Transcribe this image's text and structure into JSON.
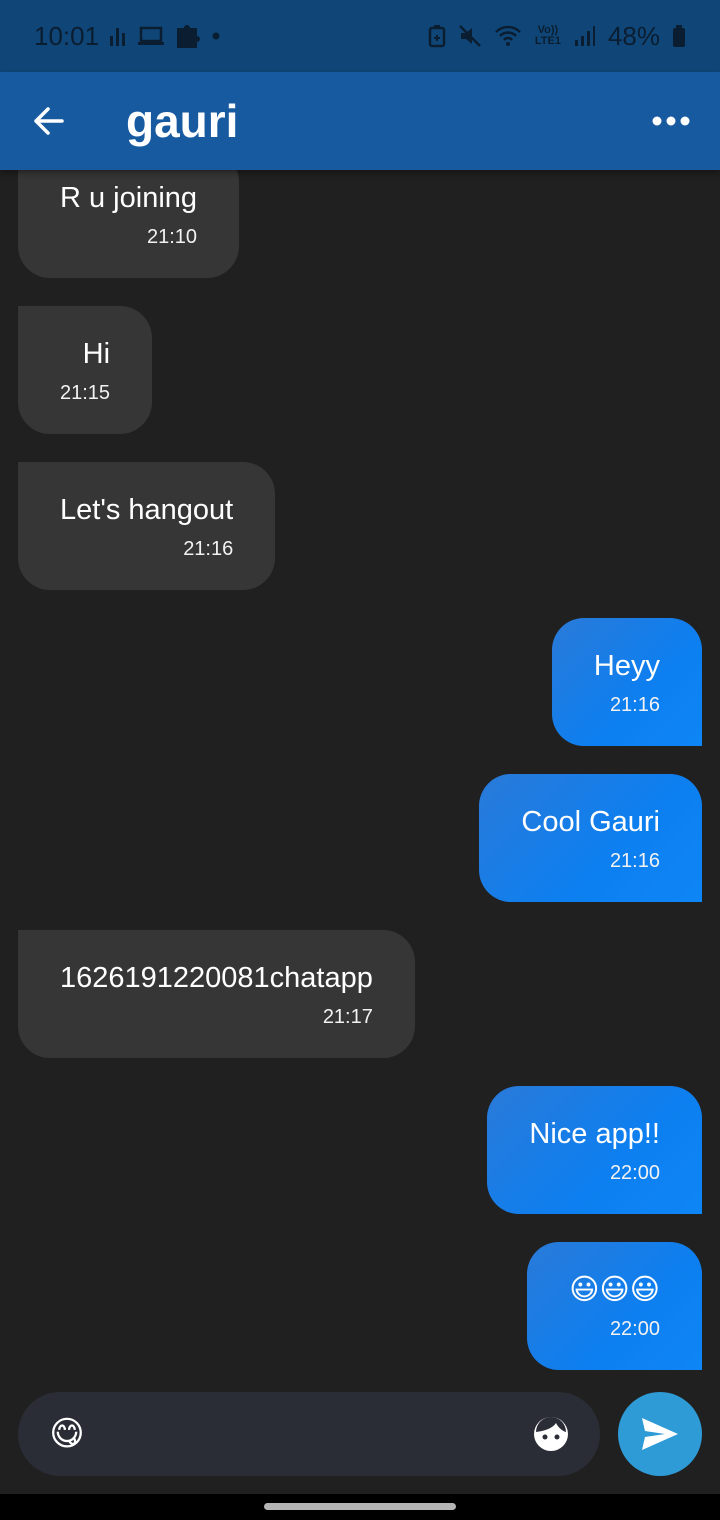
{
  "status_bar": {
    "time": "10:01",
    "battery": "48%",
    "network_label": "Vo)) LTE1"
  },
  "app_bar": {
    "title": "gauri",
    "back_icon": "arrow-left-icon",
    "more_icon": "more-horizontal-icon"
  },
  "messages": [
    {
      "direction": "incoming",
      "text": "R u joining",
      "time": "21:10"
    },
    {
      "direction": "incoming",
      "text": "Hi",
      "time": "21:15"
    },
    {
      "direction": "incoming",
      "text": "Let's hangout",
      "time": "21:16"
    },
    {
      "direction": "outgoing",
      "text": "Heyy",
      "time": "21:16"
    },
    {
      "direction": "outgoing",
      "text": "Cool Gauri",
      "time": "21:16"
    },
    {
      "direction": "incoming",
      "text": "1626191220081chatapp",
      "time": "21:17"
    },
    {
      "direction": "outgoing",
      "text": "Nice app!!",
      "time": "22:00"
    },
    {
      "direction": "outgoing",
      "text": "😃😃😃",
      "time": "22:00"
    }
  ],
  "composer": {
    "emoji_glyph": "😋",
    "value": "",
    "placeholder": ""
  },
  "colors": {
    "background": "#202020",
    "app_bar": "#175aa0",
    "status_bar": "#0f4677",
    "incoming_bubble": "#363636",
    "outgoing_bubble": "#0d7ff0",
    "send_button": "#2e9bd6",
    "composer": "#2a2d36"
  }
}
